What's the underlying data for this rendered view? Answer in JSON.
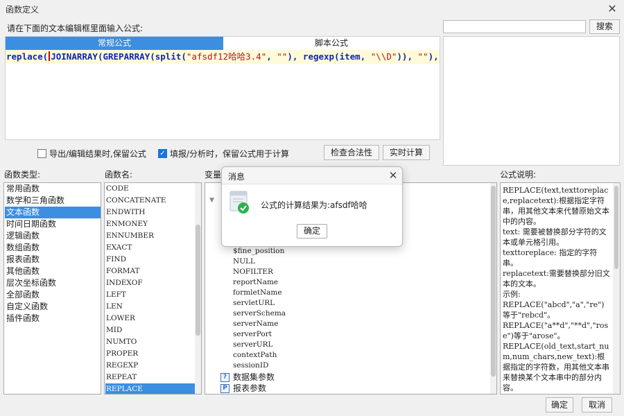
{
  "window": {
    "title": "函数定义"
  },
  "editor": {
    "prompt": "请在下面的文本编辑框里面输入公式:",
    "tab_normal": "常规公式",
    "tab_script": "脚本公式",
    "formula": {
      "part1": "replace(",
      "part2": "JOINARRAY(",
      "part3": "GREPARRAY(",
      "part4": "split(",
      "str1": "\"afsdf12哈哈3.4\"",
      "part5": ", ",
      "str2": "\"\"",
      "part6": "), ",
      "part7": "regexp(",
      "part8": "item, ",
      "str3": "\"\\\\D\"",
      "part9": ")), ",
      "str4": "\"\"",
      "part10": "),",
      "str5": "\".\"",
      "part11": ",",
      "str6": "\"\"",
      "part12": ")"
    }
  },
  "search": {
    "button": "搜索",
    "value": ""
  },
  "options": {
    "keep_on_export": {
      "label": "导出/编辑结果时,保留公式",
      "checked": false
    },
    "keep_on_fill": {
      "label": "填报/分析时，保留公式用于计算",
      "checked": true
    },
    "check_button": "检查合法性",
    "calc_button": "实时计算"
  },
  "sections": {
    "types": "函数类型:",
    "funcs": "函数名:",
    "vars": "变量",
    "desc": "公式说明:"
  },
  "function_types": [
    "常用函数",
    "数学和三角函数",
    "文本函数",
    "时间日期函数",
    "逻辑函数",
    "数组函数",
    "报表函数",
    "其他函数",
    "层次坐标函数",
    "全部函数",
    "自定义函数",
    "插件函数"
  ],
  "function_names": [
    "CODE",
    "CONCATENATE",
    "ENDWITH",
    "ENMONEY",
    "ENNUMBER",
    "EXACT",
    "FIND",
    "FORMAT",
    "INDEXOF",
    "LEFT",
    "LEN",
    "LOWER",
    "MID",
    "NUMTO",
    "PROPER",
    "REGEXP",
    "REPEAT",
    "REPLACE"
  ],
  "variables": [
    "$fine_position",
    "NULL",
    "NOFILTER",
    "reportName",
    "formletName",
    "servletURL",
    "serverSchema",
    "serverName",
    "serverPort",
    "serverURL",
    "contextPath",
    "sessionID"
  ],
  "tree_nodes": {
    "dataset_params": "数据集参数",
    "report_params": "报表参数"
  },
  "description": [
    "REPLACE(text,texttoreplace,replacetext):根据指定字符串，用其他文本来代替原始文本中的内容。",
    "text: 需要被替换部分字符的文本或单元格引用。",
    "texttoreplace: 指定的字符串。",
    "replacetext:需要替换部分旧文本的文本。",
    "示例:",
    "REPLACE(\"abcd\",\"a\",\"re\")等于\"rebcd\"。",
    "REPLACE(\"a**d\",\"**d\",\"rose\")等于\"arose\"。",
    "REPLACE(old_text,start_num,num_chars,new_text):根据指定的字符数，用其他文本串来替换某个文本串中的部分内容。"
  ],
  "footer": {
    "ok": "确定",
    "cancel": "取消"
  },
  "dialog": {
    "title": "消息",
    "message": "公式的计算结果为:afsdf哈哈",
    "ok": "确定"
  }
}
